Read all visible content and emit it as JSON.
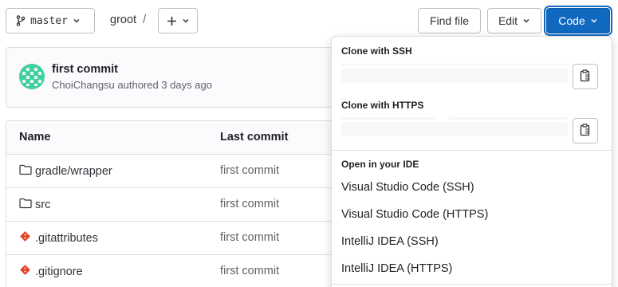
{
  "toolbar": {
    "branch": "master",
    "breadcrumb_project": "groot",
    "breadcrumb_sep": "/",
    "find_file": "Find file",
    "edit": "Edit",
    "code": "Code"
  },
  "commit": {
    "title": "first commit",
    "author_line": "ChoiChangsu authored 3 days ago"
  },
  "table": {
    "headers": {
      "name": "Name",
      "last_commit": "Last commit"
    },
    "rows": [
      {
        "name": "gradle/wrapper",
        "icon": "folder-icon",
        "last_commit": "first commit"
      },
      {
        "name": "src",
        "icon": "folder-icon",
        "last_commit": "first commit"
      },
      {
        "name": ".gitattributes",
        "icon": "git-file-icon",
        "last_commit": "first commit"
      },
      {
        "name": ".gitignore",
        "icon": "git-file-icon",
        "last_commit": "first commit"
      }
    ]
  },
  "clone_dropdown": {
    "ssh_label": "Clone with SSH",
    "https_label": "Clone with HTTPS",
    "ide_label": "Open in your IDE",
    "ide_items": [
      "Visual Studio Code (SSH)",
      "Visual Studio Code (HTTPS)",
      "IntelliJ IDEA (SSH)",
      "IntelliJ IDEA (HTTPS)"
    ]
  },
  "colors": {
    "primary": "#1068bf",
    "avatar": "#3fd0a0",
    "git_icon": "#e24329"
  }
}
